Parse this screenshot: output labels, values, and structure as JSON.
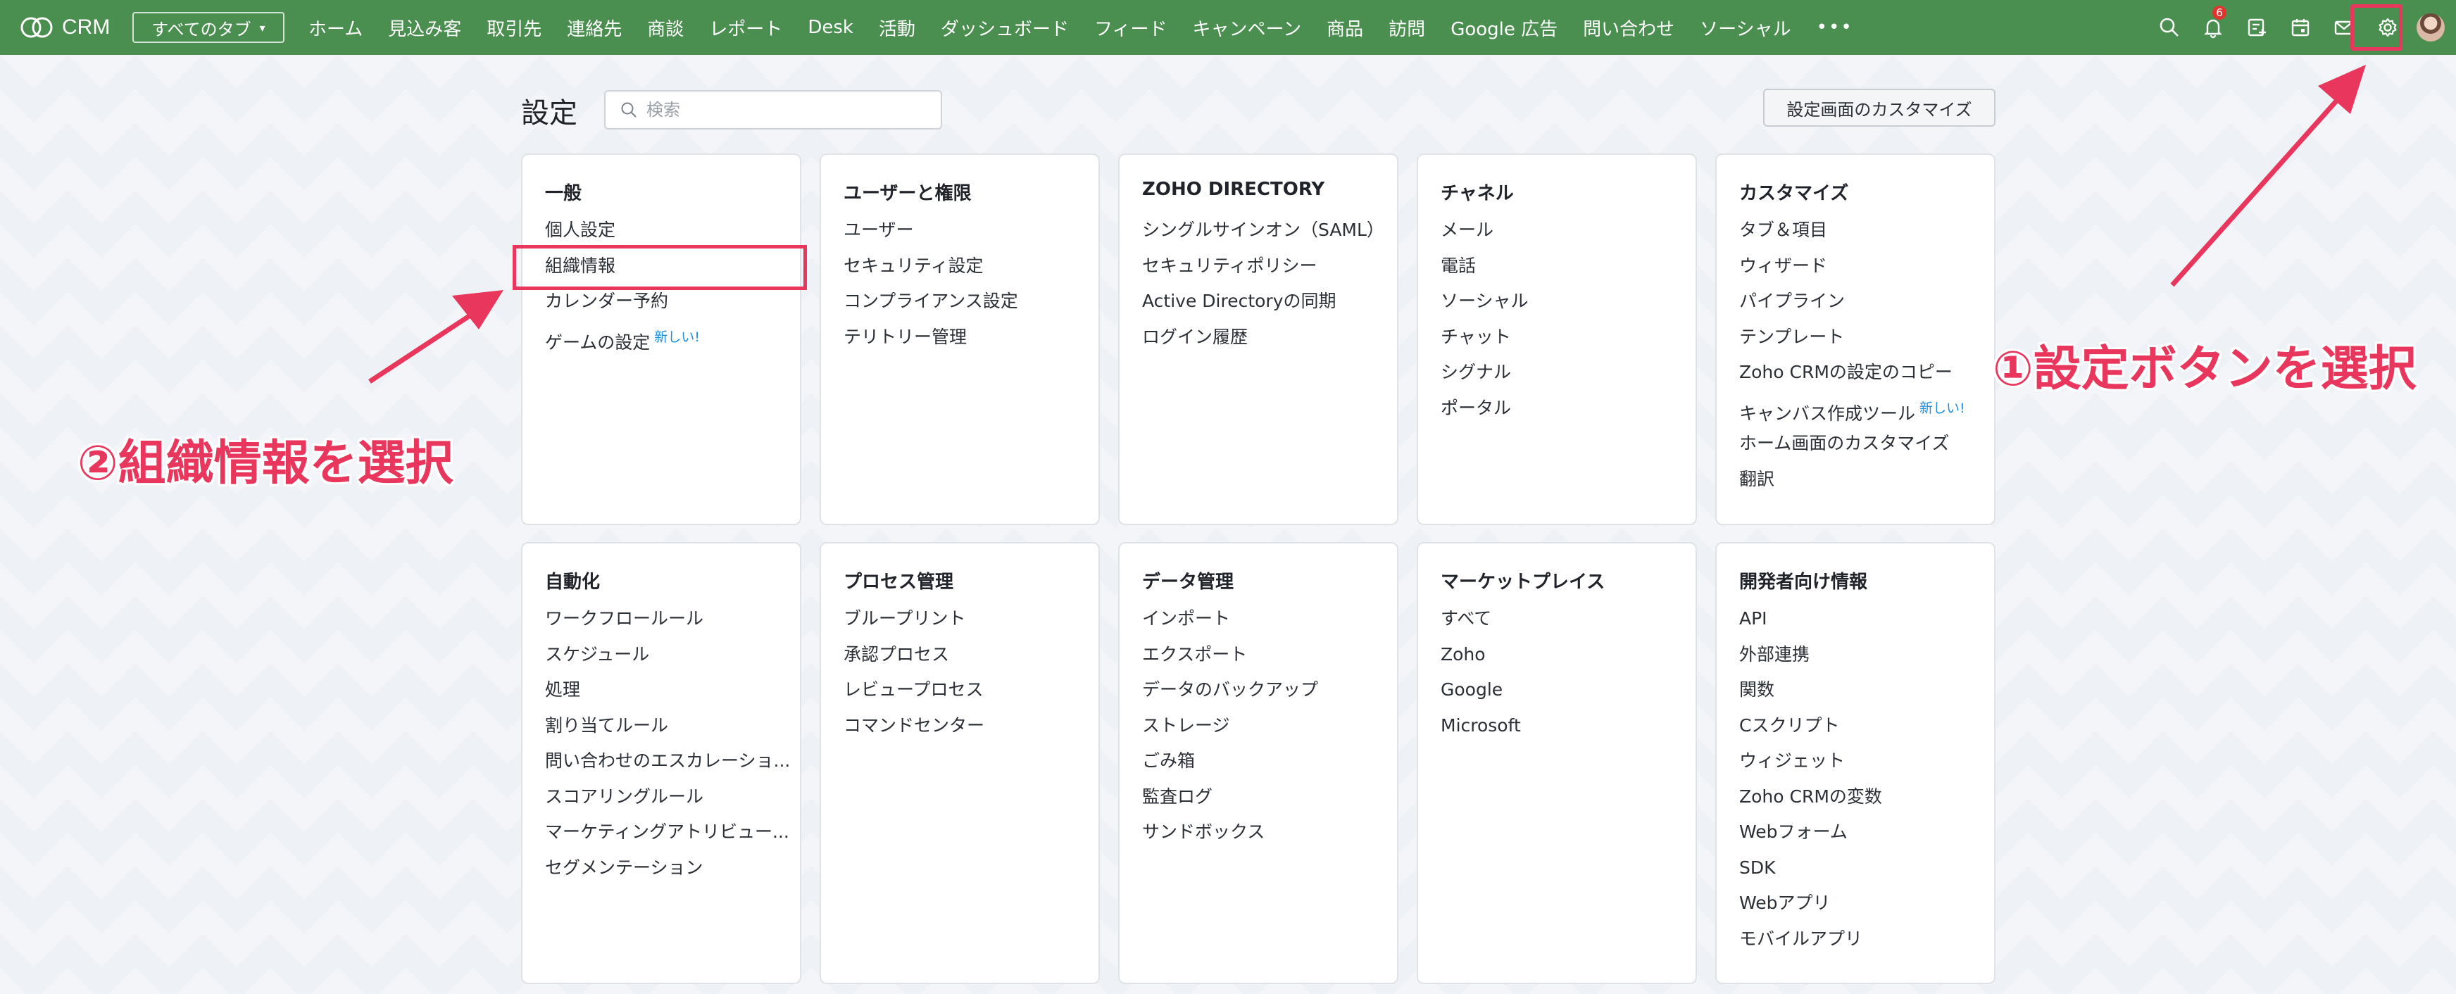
{
  "topbar": {
    "logo_text": "CRM",
    "tabs_dropdown": "すべてのタブ",
    "nav": [
      "ホーム",
      "見込み客",
      "取引先",
      "連絡先",
      "商談",
      "レポート",
      "Desk",
      "活動",
      "ダッシュボード",
      "フィード",
      "キャンペーン",
      "商品",
      "訪問",
      "Google 広告",
      "問い合わせ",
      "ソーシャル"
    ],
    "more": "•••",
    "notification_count": "6",
    "bg_color": "#4a8f4f"
  },
  "header": {
    "title": "設定",
    "search_placeholder": "検索",
    "customize_button": "設定画面のカスタマイズ"
  },
  "new_label": "新しい!",
  "cards_row1": [
    {
      "title": "一般",
      "items": [
        {
          "label": "個人設定"
        },
        {
          "label": "組織情報"
        },
        {
          "label": "カレンダー予約"
        },
        {
          "label": "ゲームの設定",
          "new": true
        }
      ]
    },
    {
      "title": "ユーザーと権限",
      "items": [
        {
          "label": "ユーザー"
        },
        {
          "label": "セキュリティ設定"
        },
        {
          "label": "コンプライアンス設定"
        },
        {
          "label": "テリトリー管理"
        }
      ]
    },
    {
      "title": "ZOHO DIRECTORY",
      "items": [
        {
          "label": "シングルサインオン（SAML）"
        },
        {
          "label": "セキュリティポリシー"
        },
        {
          "label": "Active Directoryの同期"
        },
        {
          "label": "ログイン履歴"
        }
      ]
    },
    {
      "title": "チャネル",
      "items": [
        {
          "label": "メール"
        },
        {
          "label": "電話"
        },
        {
          "label": "ソーシャル"
        },
        {
          "label": "チャット"
        },
        {
          "label": "シグナル"
        },
        {
          "label": "ポータル"
        }
      ]
    },
    {
      "title": "カスタマイズ",
      "items": [
        {
          "label": "タブ＆項目"
        },
        {
          "label": "ウィザード"
        },
        {
          "label": "パイプライン"
        },
        {
          "label": "テンプレート"
        },
        {
          "label": "Zoho CRMの設定のコピー"
        },
        {
          "label": "キャンバス作成ツール",
          "new": true
        },
        {
          "label": "ホーム画面のカスタマイズ"
        },
        {
          "label": "翻訳"
        }
      ]
    }
  ],
  "cards_row2": [
    {
      "title": "自動化",
      "items": [
        {
          "label": "ワークフロールール"
        },
        {
          "label": "スケジュール"
        },
        {
          "label": "処理"
        },
        {
          "label": "割り当てルール"
        },
        {
          "label": "問い合わせのエスカレーショ..."
        },
        {
          "label": "スコアリングルール"
        },
        {
          "label": "マーケティングアトリビュー..."
        },
        {
          "label": "セグメンテーション"
        }
      ]
    },
    {
      "title": "プロセス管理",
      "items": [
        {
          "label": "ブループリント"
        },
        {
          "label": "承認プロセス"
        },
        {
          "label": "レビュープロセス"
        },
        {
          "label": "コマンドセンター"
        }
      ]
    },
    {
      "title": "データ管理",
      "items": [
        {
          "label": "インポート"
        },
        {
          "label": "エクスポート"
        },
        {
          "label": "データのバックアップ"
        },
        {
          "label": "ストレージ"
        },
        {
          "label": "ごみ箱"
        },
        {
          "label": "監査ログ"
        },
        {
          "label": "サンドボックス"
        }
      ]
    },
    {
      "title": "マーケットプレイス",
      "items": [
        {
          "label": "すべて"
        },
        {
          "label": "Zoho"
        },
        {
          "label": "Google"
        },
        {
          "label": "Microsoft"
        }
      ]
    },
    {
      "title": "開発者向け情報",
      "items": [
        {
          "label": "API"
        },
        {
          "label": "外部連携"
        },
        {
          "label": "関数"
        },
        {
          "label": "Cスクリプト"
        },
        {
          "label": "ウィジェット"
        },
        {
          "label": "Zoho CRMの変数"
        },
        {
          "label": "Webフォーム"
        },
        {
          "label": "SDK"
        },
        {
          "label": "Webアプリ"
        },
        {
          "label": "モバイルアプリ"
        }
      ]
    }
  ],
  "annotations": {
    "step1": "①設定ボタンを選択",
    "step2": "②組織情報を選択",
    "color": "#e8365d"
  }
}
